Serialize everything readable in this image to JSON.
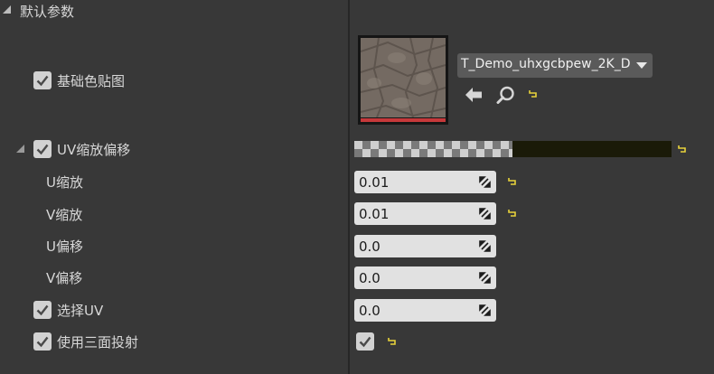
{
  "section": {
    "title": "默认参数"
  },
  "texture": {
    "label": "基础色贴图",
    "asset_name": "T_Demo_uhxgcbpew_2K_D",
    "icons": [
      "use-selected-arrow-icon",
      "browse-magnifier-icon",
      "reset-to-default-icon"
    ]
  },
  "uv_offset": {
    "label": "UV缩放偏移",
    "children": [
      {
        "label": "U缩放",
        "value": "0.01",
        "has_reset": true
      },
      {
        "label": "V缩放",
        "value": "0.01",
        "has_reset": true
      },
      {
        "label": "U偏移",
        "value": "0.0",
        "has_reset": false
      },
      {
        "label": "V偏移",
        "value": "0.0",
        "has_reset": false
      }
    ]
  },
  "select_uv": {
    "label": "选择UV",
    "value": "0.0"
  },
  "triplanar": {
    "label": "使用三面投射",
    "checked": true
  },
  "colors": {
    "background": "#383838",
    "divider": "#262626",
    "reset_icon": "#e8d23a",
    "texture_bar": "#c6383a",
    "swatch": "#1a1a08"
  }
}
